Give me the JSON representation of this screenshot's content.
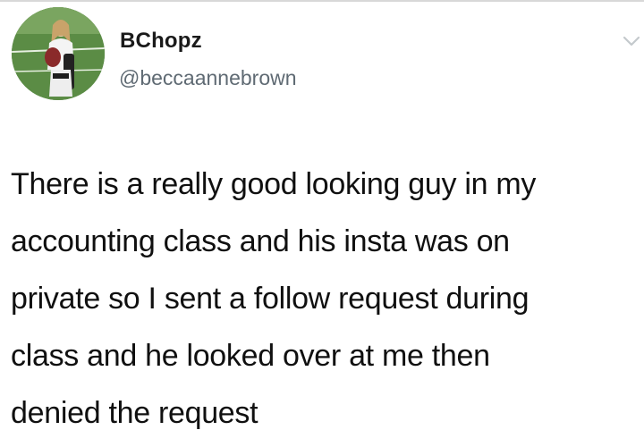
{
  "tweet": {
    "author": {
      "display_name": "BChopz",
      "handle": "@beccaannebrown"
    },
    "text_lines": [
      "There is a really good looking guy in my",
      "accounting class and his insta was on",
      "private so I sent a follow request during",
      "class and he looked over at me then",
      "denied the request"
    ]
  },
  "icons": {
    "avatar": "profile-photo",
    "menu": "chevron-down-icon"
  },
  "colors": {
    "background": "#ffffff",
    "text": "#101010",
    "handle": "#5f6a73",
    "chevron": "#c4c9cc"
  }
}
